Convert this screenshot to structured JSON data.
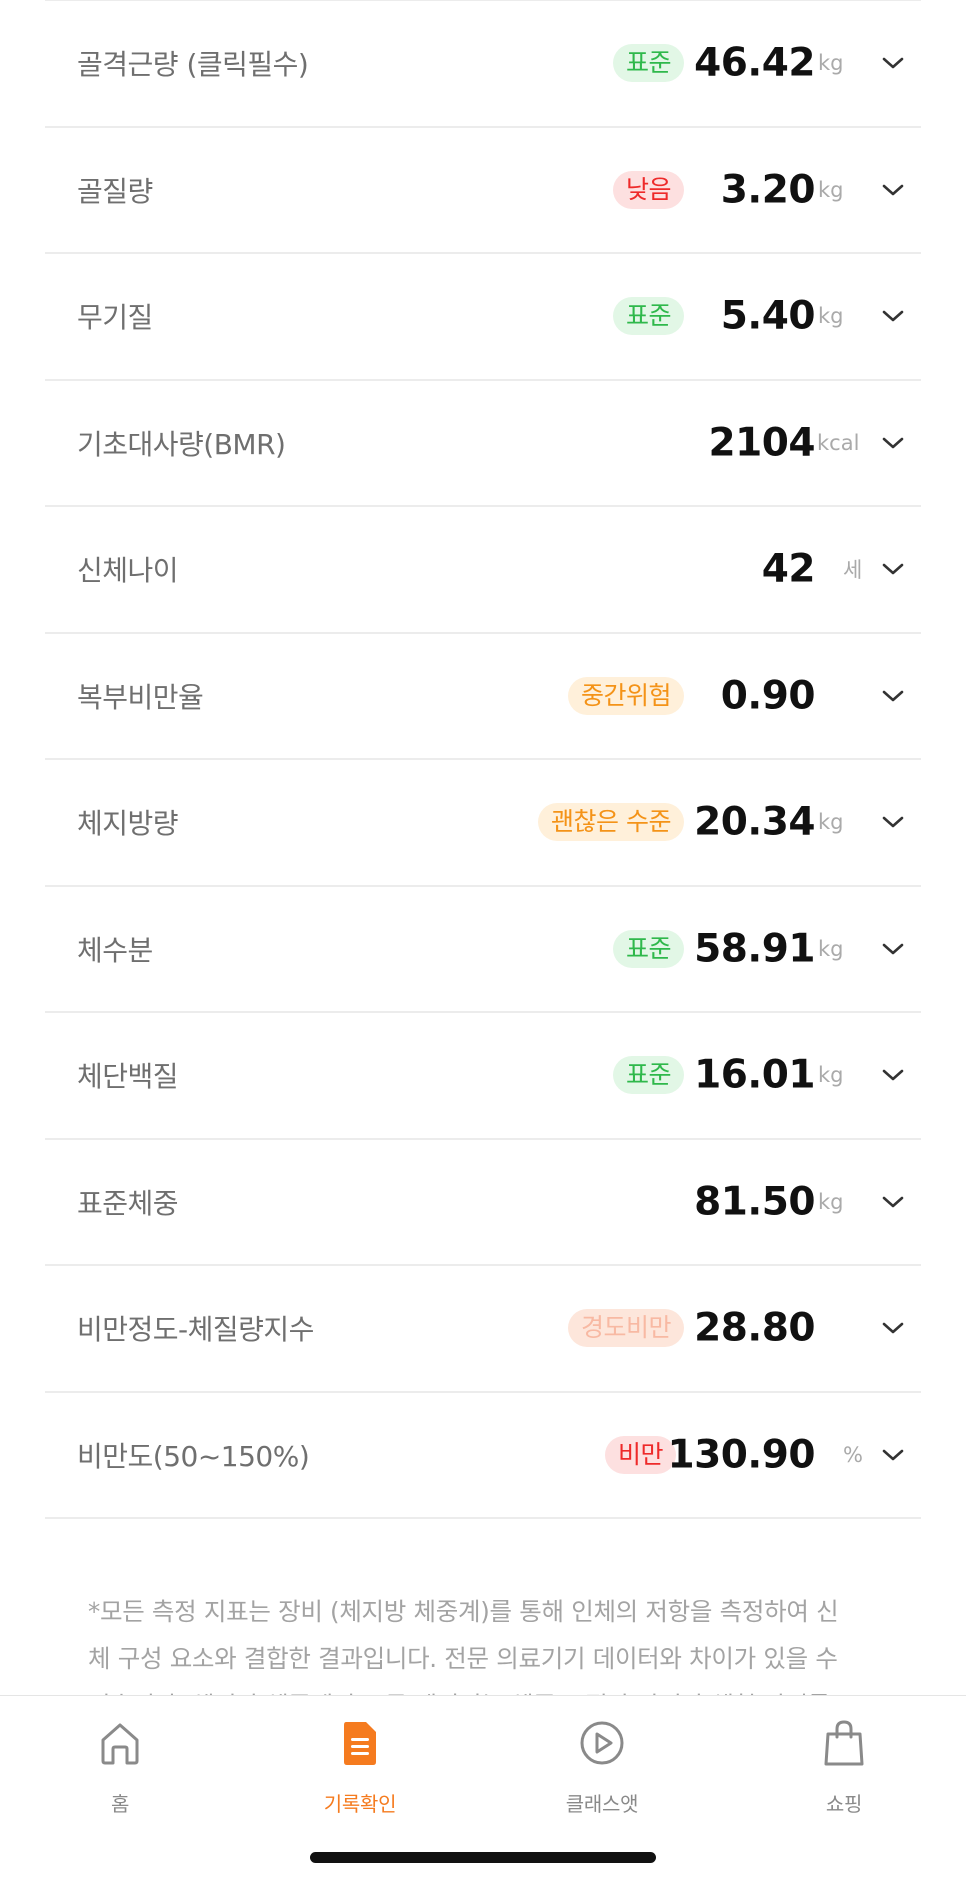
{
  "metrics": [
    {
      "label": "골격근량 (클릭필수)",
      "badge": "표준",
      "badge_type": "green",
      "value": "46.42",
      "unit": "kg"
    },
    {
      "label": "골질량",
      "badge": "낮음",
      "badge_type": "red",
      "value": "3.20",
      "unit": "kg"
    },
    {
      "label": "무기질",
      "badge": "표준",
      "badge_type": "green",
      "value": "5.40",
      "unit": "kg"
    },
    {
      "label": "기초대사량(BMR)",
      "badge": "",
      "badge_type": "",
      "value": "2104",
      "unit": "kcal"
    },
    {
      "label": "신체나이",
      "badge": "",
      "badge_type": "",
      "value": "42",
      "unit": "세"
    },
    {
      "label": "복부비만율",
      "badge": "중간위험",
      "badge_type": "orange",
      "value": "0.90",
      "unit": ""
    },
    {
      "label": "체지방량",
      "badge": "괜찮은 수준",
      "badge_type": "orange",
      "value": "20.34",
      "unit": "kg"
    },
    {
      "label": "체수분",
      "badge": "표준",
      "badge_type": "green",
      "value": "58.91",
      "unit": "kg"
    },
    {
      "label": "체단백질",
      "badge": "표준",
      "badge_type": "green",
      "value": "16.01",
      "unit": "kg"
    },
    {
      "label": "표준체중",
      "badge": "",
      "badge_type": "",
      "value": "81.50",
      "unit": "kg"
    },
    {
      "label": "비만정도-체질량지수",
      "badge": "경도비만",
      "badge_type": "faded",
      "value": "28.80",
      "unit": ""
    },
    {
      "label": "비만도(50~150%)",
      "badge": "비만",
      "badge_type": "red",
      "value": "130.90",
      "unit": "%"
    }
  ],
  "notice": {
    "line1": "*모든 측정 지표는 장비 (체지방 체중계)를 통해 인체의 저항을 측정하여 신",
    "line2": "체 구성 요소와 결합한 결과입니다. 전문 의료기기 데이터와 차이가 있을 수",
    "line3": "있습니다. 체지방 체중계의 모든 데이터는 체중 조절과 자기가 체형 관리를"
  },
  "tabbar": {
    "home": "홈",
    "records": "기록확인",
    "class": "클래스앳",
    "shopping": "쇼핑"
  },
  "colors": {
    "accent": "#f57b1f",
    "badge_green": "#2fb84b",
    "badge_red": "#ee2a2a",
    "badge_orange": "#f49318"
  }
}
